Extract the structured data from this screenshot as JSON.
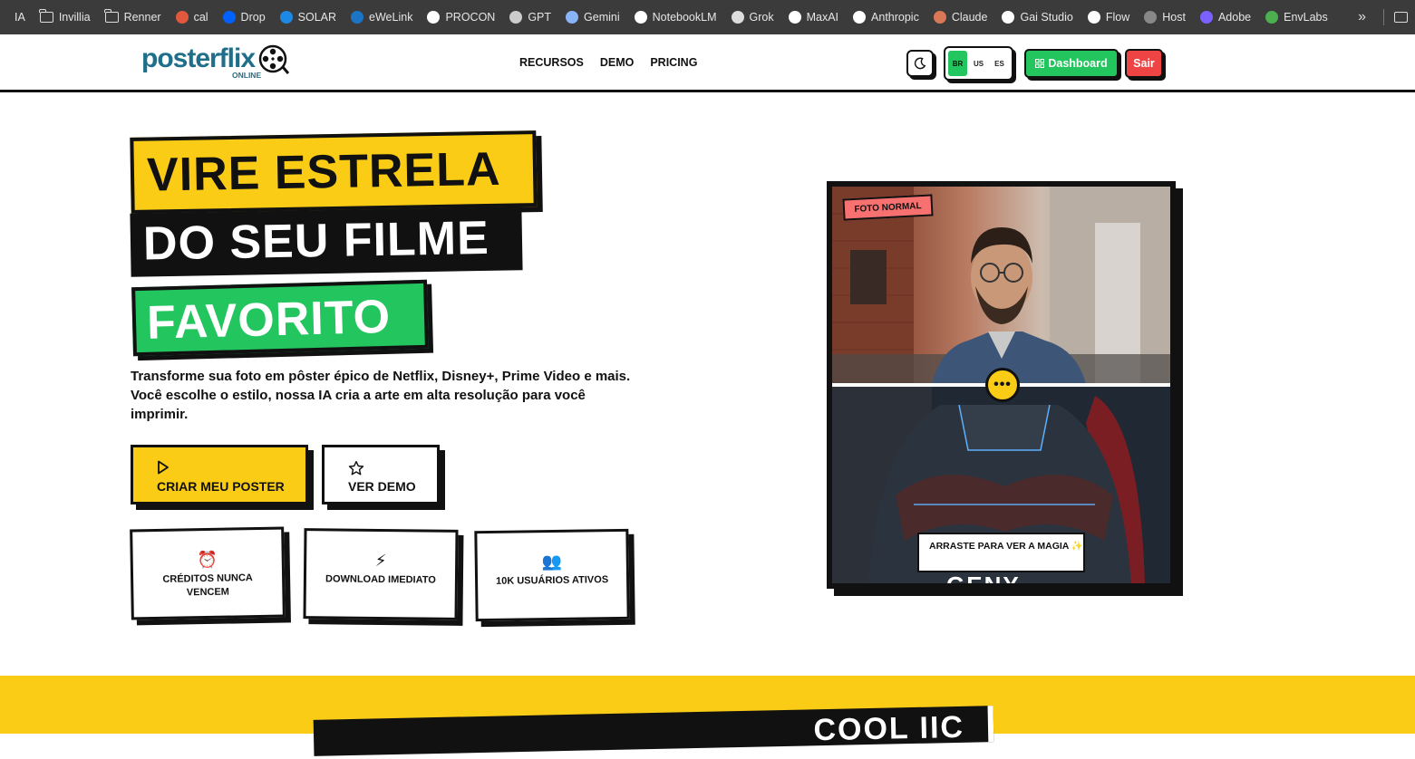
{
  "bookmarks": [
    {
      "label": "IA",
      "icon": "none"
    },
    {
      "label": "Invillia",
      "icon": "folder-icon"
    },
    {
      "label": "Renner",
      "icon": "folder-icon"
    },
    {
      "label": "cal",
      "icon": "cal-icon",
      "color": "#e2583e"
    },
    {
      "label": "Drop",
      "icon": "dropbox-icon",
      "color": "#0061fe"
    },
    {
      "label": "SOLAR",
      "icon": "solar-icon",
      "color": "#1e88e5"
    },
    {
      "label": "eWeLink",
      "icon": "ewelink-icon",
      "color": "#1b74c5"
    },
    {
      "label": "PROCON",
      "icon": "procon-icon",
      "color": "#ffffff"
    },
    {
      "label": "GPT",
      "icon": "openai-icon",
      "color": "#cccccc"
    },
    {
      "label": "Gemini",
      "icon": "gemini-icon",
      "color": "#8ab4f8"
    },
    {
      "label": "NotebookLM",
      "icon": "notebooklm-icon",
      "color": "#ffffff"
    },
    {
      "label": "Grok",
      "icon": "grok-icon",
      "color": "#dddddd"
    },
    {
      "label": "MaxAI",
      "icon": "maxai-icon",
      "color": "#ffffff"
    },
    {
      "label": "Anthropic",
      "icon": "anthropic-icon",
      "color": "#ffffff"
    },
    {
      "label": "Claude",
      "icon": "claude-icon",
      "color": "#d97757"
    },
    {
      "label": "Gai Studio",
      "icon": "gai-studio-icon",
      "color": "#ffffff"
    },
    {
      "label": "Flow",
      "icon": "flow-icon",
      "color": "#ffffff"
    },
    {
      "label": "Host",
      "icon": "host-icon",
      "color": "#888888"
    },
    {
      "label": "Adobe",
      "icon": "adobe-icon",
      "color": "#7b61ff"
    },
    {
      "label": "EnvLabs",
      "icon": "envlabs-icon",
      "color": "#4caf50"
    }
  ],
  "bookmarks_more": "»",
  "header": {
    "logo_text": "posterflix",
    "logo_sub": "ONLINE",
    "nav": [
      "RECURSOS",
      "DEMO",
      "PRICING"
    ],
    "languages": [
      "BR",
      "US",
      "ES"
    ],
    "active_language": "BR",
    "dashboard_label": "Dashboard",
    "logout_label": "Sair",
    "colors": {
      "brand": "#1f6f8b",
      "green": "#22c55e",
      "red": "#ef4444",
      "yellow": "#facc15"
    }
  },
  "hero": {
    "headline_1": "VIRE ESTRELA",
    "headline_2": "DO SEU FILME",
    "headline_3": "FAVORITO",
    "desc_pre": "Transforme sua foto em pôster épico de ",
    "desc_netflix": "Netflix",
    "desc_sep1": ", ",
    "desc_disney": "Disney+",
    "desc_sep2": ", ",
    "desc_prime": "Prime Video",
    "desc_post": " e mais. Você escolhe o estilo, nossa IA cria a arte em alta resolução para você imprimir.",
    "cta_primary": "CRIAR MEU POSTER",
    "cta_secondary": "VER DEMO",
    "features": [
      {
        "icon": "alarm-clock-icon",
        "glyph": "⏰",
        "label": "CRÉDITOS NUNCA VENCEM"
      },
      {
        "icon": "lightning-icon",
        "glyph": "⚡",
        "label": "DOWNLOAD IMEDIATO"
      },
      {
        "icon": "users-icon",
        "glyph": "👥",
        "label": "10K USUÁRIOS ATIVOS"
      }
    ]
  },
  "compare": {
    "badge": "FOTO NORMAL",
    "hint": "ARRASTE PARA VER A MAGIA ✨",
    "slider_glyph": "•••",
    "poster_word": "GENY"
  },
  "next_section": {
    "title_fragment": "COOL IIC"
  }
}
